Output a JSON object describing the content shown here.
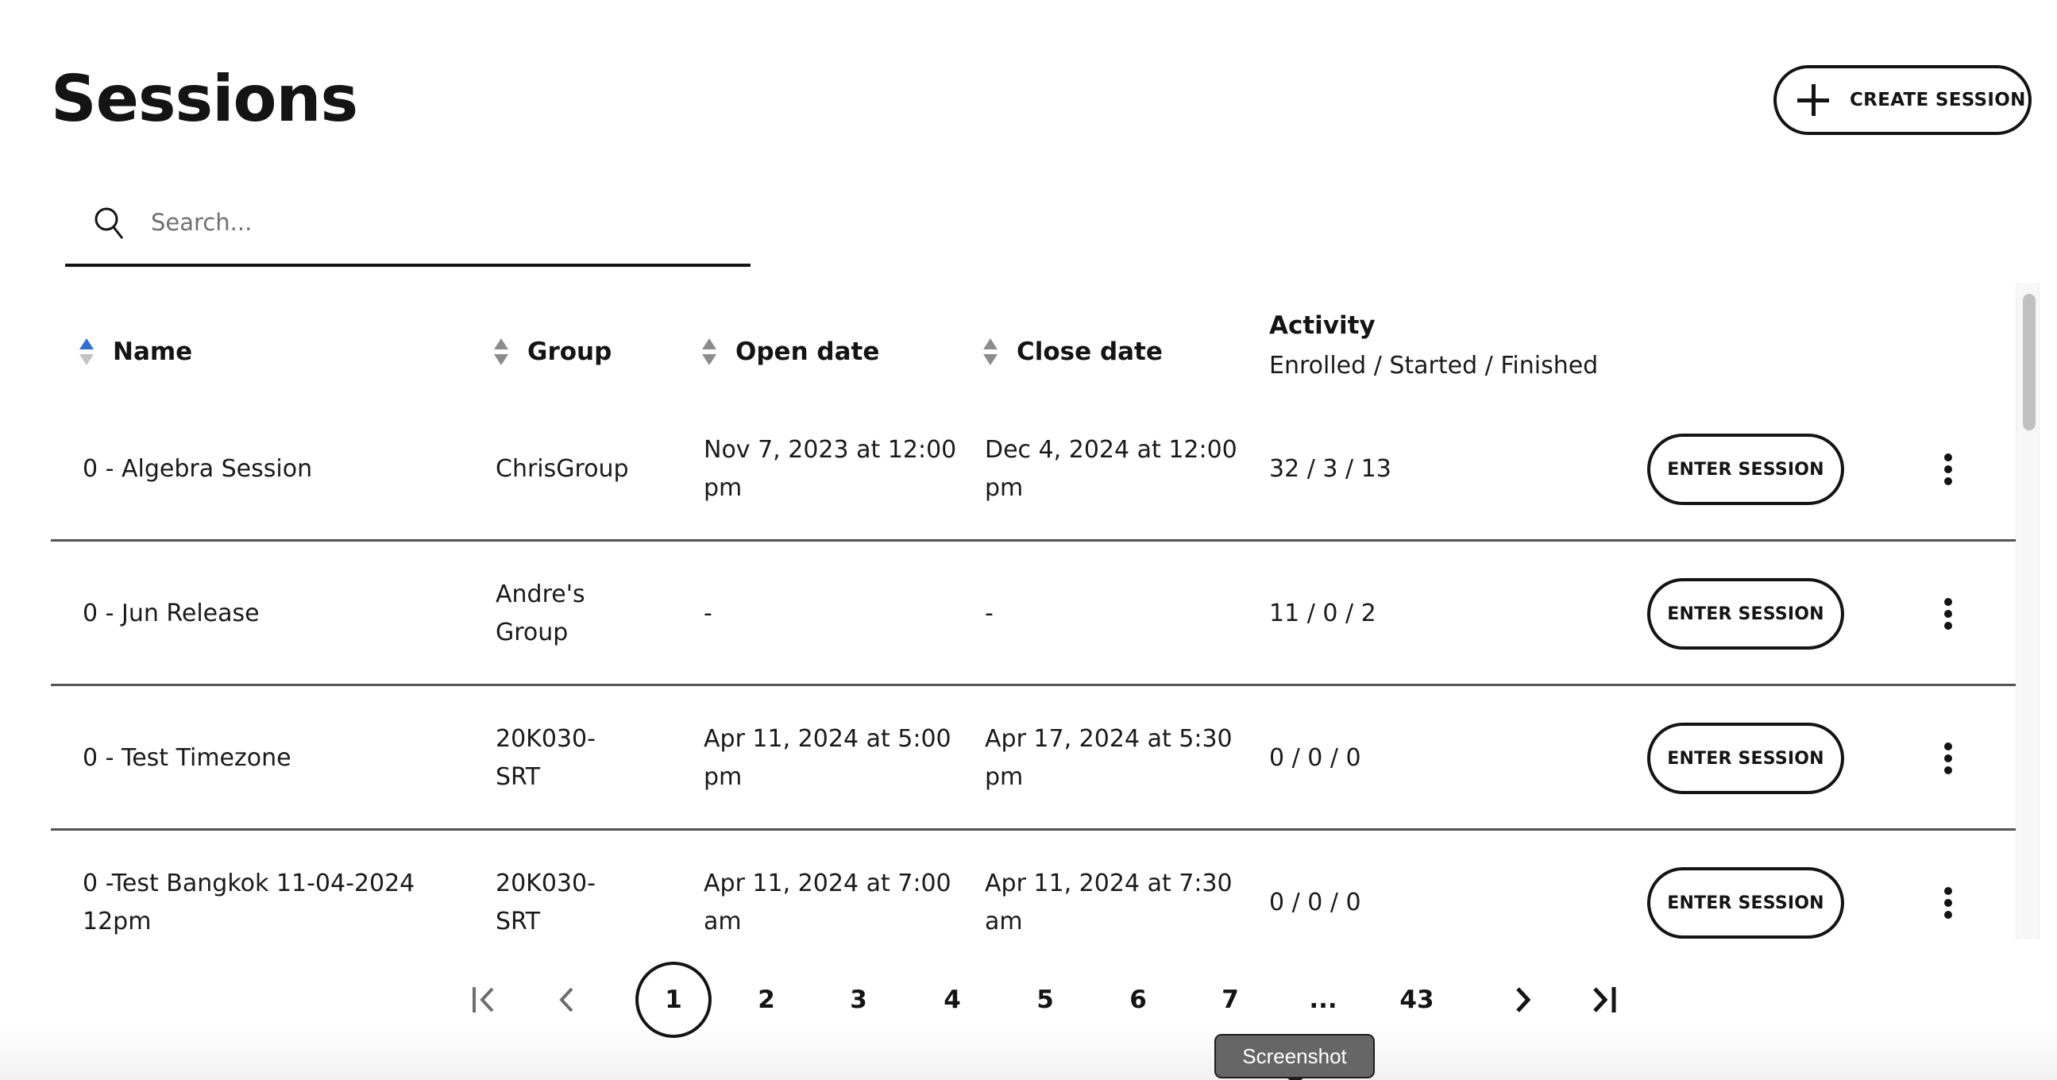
{
  "header": {
    "title": "Sessions",
    "create_button_label": "CREATE SESSION",
    "create_icon": "plus-icon"
  },
  "search": {
    "placeholder": "Search...",
    "value": "",
    "icon": "search-icon"
  },
  "table": {
    "columns": {
      "name": {
        "label": "Name",
        "sort": "ascending"
      },
      "group": {
        "label": "Group",
        "sort": "none"
      },
      "open_date": {
        "label": "Open date",
        "sort": "none"
      },
      "close_date": {
        "label": "Close date",
        "sort": "none"
      },
      "activity": {
        "label": "Activity",
        "sublabel": "Enrolled / Started / Finished"
      }
    },
    "rows": [
      {
        "name": "0 - Algebra Session",
        "group": "ChrisGroup",
        "open_date": "Nov 7, 2023 at 12:00 pm",
        "close_date": "Dec 4, 2024 at 12:00 pm",
        "activity": "32 / 3 / 13",
        "action_label": "ENTER SESSION"
      },
      {
        "name": "0 - Jun Release",
        "group": "Andre's Group",
        "open_date": "-",
        "close_date": "-",
        "activity": "11 / 0 / 2",
        "action_label": "ENTER SESSION"
      },
      {
        "name": "0 - Test Timezone",
        "group": "20K030-SRT",
        "open_date": "Apr 11, 2024 at 5:00 pm",
        "close_date": "Apr 17, 2024 at 5:30 pm",
        "activity": "0 / 0 / 0",
        "action_label": "ENTER SESSION"
      },
      {
        "name": "0 -Test Bangkok 11-04-2024 12pm",
        "group": "20K030-SRT",
        "open_date": "Apr 11, 2024 at 7:00 am",
        "close_date": "Apr 11, 2024 at 7:30 am",
        "activity": "0 / 0 / 0",
        "action_label": "ENTER SESSION"
      }
    ]
  },
  "pagination": {
    "current_page": 1,
    "pages": [
      "1",
      "2",
      "3",
      "4",
      "5",
      "6",
      "7",
      "...",
      "43"
    ],
    "first_icon": "first-page-icon",
    "prev_icon": "chevron-left-icon",
    "next_icon": "chevron-right-icon",
    "last_icon": "last-page-icon",
    "first_prev_disabled": true
  },
  "tooltip": {
    "text": "Screenshot"
  },
  "colors": {
    "sort_active": "#2f6fd0",
    "sort_inactive": "#8c8c8c",
    "text": "#141414",
    "disabled_arrow": "#6e6e6e",
    "tooltip_bg": "#666666"
  }
}
